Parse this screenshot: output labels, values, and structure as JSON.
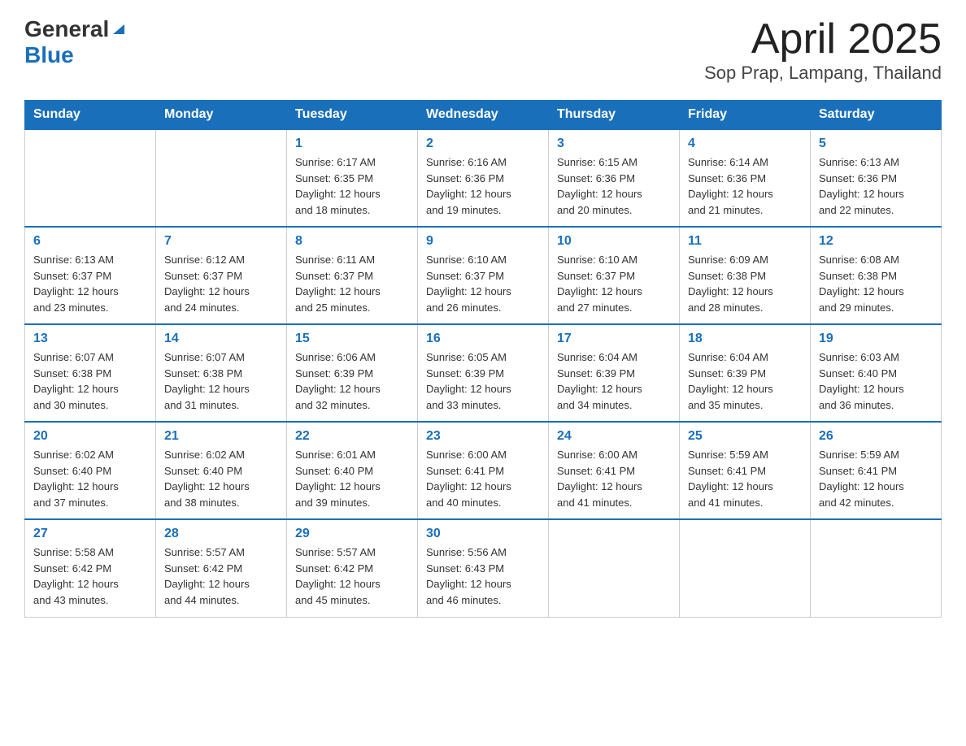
{
  "header": {
    "logo_general": "General",
    "logo_blue": "Blue",
    "month_title": "April 2025",
    "location": "Sop Prap, Lampang, Thailand"
  },
  "days_of_week": [
    "Sunday",
    "Monday",
    "Tuesday",
    "Wednesday",
    "Thursday",
    "Friday",
    "Saturday"
  ],
  "weeks": [
    [
      {
        "day": "",
        "info": ""
      },
      {
        "day": "",
        "info": ""
      },
      {
        "day": "1",
        "info": "Sunrise: 6:17 AM\nSunset: 6:35 PM\nDaylight: 12 hours\nand 18 minutes."
      },
      {
        "day": "2",
        "info": "Sunrise: 6:16 AM\nSunset: 6:36 PM\nDaylight: 12 hours\nand 19 minutes."
      },
      {
        "day": "3",
        "info": "Sunrise: 6:15 AM\nSunset: 6:36 PM\nDaylight: 12 hours\nand 20 minutes."
      },
      {
        "day": "4",
        "info": "Sunrise: 6:14 AM\nSunset: 6:36 PM\nDaylight: 12 hours\nand 21 minutes."
      },
      {
        "day": "5",
        "info": "Sunrise: 6:13 AM\nSunset: 6:36 PM\nDaylight: 12 hours\nand 22 minutes."
      }
    ],
    [
      {
        "day": "6",
        "info": "Sunrise: 6:13 AM\nSunset: 6:37 PM\nDaylight: 12 hours\nand 23 minutes."
      },
      {
        "day": "7",
        "info": "Sunrise: 6:12 AM\nSunset: 6:37 PM\nDaylight: 12 hours\nand 24 minutes."
      },
      {
        "day": "8",
        "info": "Sunrise: 6:11 AM\nSunset: 6:37 PM\nDaylight: 12 hours\nand 25 minutes."
      },
      {
        "day": "9",
        "info": "Sunrise: 6:10 AM\nSunset: 6:37 PM\nDaylight: 12 hours\nand 26 minutes."
      },
      {
        "day": "10",
        "info": "Sunrise: 6:10 AM\nSunset: 6:37 PM\nDaylight: 12 hours\nand 27 minutes."
      },
      {
        "day": "11",
        "info": "Sunrise: 6:09 AM\nSunset: 6:38 PM\nDaylight: 12 hours\nand 28 minutes."
      },
      {
        "day": "12",
        "info": "Sunrise: 6:08 AM\nSunset: 6:38 PM\nDaylight: 12 hours\nand 29 minutes."
      }
    ],
    [
      {
        "day": "13",
        "info": "Sunrise: 6:07 AM\nSunset: 6:38 PM\nDaylight: 12 hours\nand 30 minutes."
      },
      {
        "day": "14",
        "info": "Sunrise: 6:07 AM\nSunset: 6:38 PM\nDaylight: 12 hours\nand 31 minutes."
      },
      {
        "day": "15",
        "info": "Sunrise: 6:06 AM\nSunset: 6:39 PM\nDaylight: 12 hours\nand 32 minutes."
      },
      {
        "day": "16",
        "info": "Sunrise: 6:05 AM\nSunset: 6:39 PM\nDaylight: 12 hours\nand 33 minutes."
      },
      {
        "day": "17",
        "info": "Sunrise: 6:04 AM\nSunset: 6:39 PM\nDaylight: 12 hours\nand 34 minutes."
      },
      {
        "day": "18",
        "info": "Sunrise: 6:04 AM\nSunset: 6:39 PM\nDaylight: 12 hours\nand 35 minutes."
      },
      {
        "day": "19",
        "info": "Sunrise: 6:03 AM\nSunset: 6:40 PM\nDaylight: 12 hours\nand 36 minutes."
      }
    ],
    [
      {
        "day": "20",
        "info": "Sunrise: 6:02 AM\nSunset: 6:40 PM\nDaylight: 12 hours\nand 37 minutes."
      },
      {
        "day": "21",
        "info": "Sunrise: 6:02 AM\nSunset: 6:40 PM\nDaylight: 12 hours\nand 38 minutes."
      },
      {
        "day": "22",
        "info": "Sunrise: 6:01 AM\nSunset: 6:40 PM\nDaylight: 12 hours\nand 39 minutes."
      },
      {
        "day": "23",
        "info": "Sunrise: 6:00 AM\nSunset: 6:41 PM\nDaylight: 12 hours\nand 40 minutes."
      },
      {
        "day": "24",
        "info": "Sunrise: 6:00 AM\nSunset: 6:41 PM\nDaylight: 12 hours\nand 41 minutes."
      },
      {
        "day": "25",
        "info": "Sunrise: 5:59 AM\nSunset: 6:41 PM\nDaylight: 12 hours\nand 41 minutes."
      },
      {
        "day": "26",
        "info": "Sunrise: 5:59 AM\nSunset: 6:41 PM\nDaylight: 12 hours\nand 42 minutes."
      }
    ],
    [
      {
        "day": "27",
        "info": "Sunrise: 5:58 AM\nSunset: 6:42 PM\nDaylight: 12 hours\nand 43 minutes."
      },
      {
        "day": "28",
        "info": "Sunrise: 5:57 AM\nSunset: 6:42 PM\nDaylight: 12 hours\nand 44 minutes."
      },
      {
        "day": "29",
        "info": "Sunrise: 5:57 AM\nSunset: 6:42 PM\nDaylight: 12 hours\nand 45 minutes."
      },
      {
        "day": "30",
        "info": "Sunrise: 5:56 AM\nSunset: 6:43 PM\nDaylight: 12 hours\nand 46 minutes."
      },
      {
        "day": "",
        "info": ""
      },
      {
        "day": "",
        "info": ""
      },
      {
        "day": "",
        "info": ""
      }
    ]
  ]
}
